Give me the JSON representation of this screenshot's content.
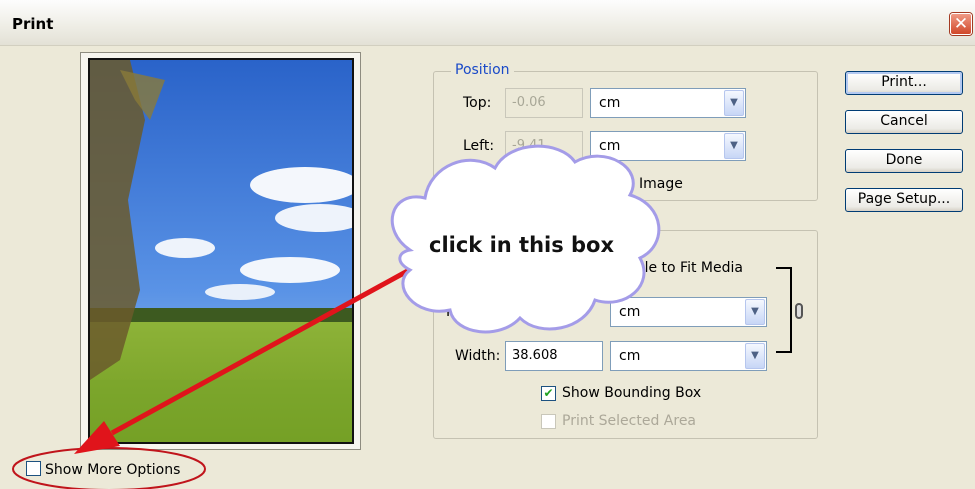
{
  "dialog": {
    "title": "Print",
    "close_glyph": "✕"
  },
  "position": {
    "legend": "Position",
    "top_label": "Top:",
    "top_value": "-0.06",
    "top_unit": "cm",
    "left_label": "Left:",
    "left_value": "-9.41",
    "left_unit": "cm",
    "center_image_partial": "Image"
  },
  "scaled": {
    "scale_to_fit_partial": "ale to Fit Media",
    "height_label_partial": "Heig",
    "height_unit_partial": "cm",
    "width_label": "Width:",
    "width_value": "38.608",
    "width_unit": "cm",
    "show_bounding_box": "Show Bounding Box",
    "show_bounding_box_checked": true,
    "print_selected_area": "Print Selected Area",
    "print_selected_area_checked": false
  },
  "buttons": {
    "print": "Print...",
    "cancel": "Cancel",
    "done": "Done",
    "page_setup": "Page Setup..."
  },
  "show_more_options": {
    "label": "Show More Options",
    "checked": false
  },
  "annotation": {
    "callout_text": "click in this box",
    "arrow_color": "#e0141b",
    "callout_border_color": "#a49ce8"
  },
  "icons": {
    "link": "chain-link-icon",
    "dropdown": "chevron-down-icon",
    "check": "checkmark-icon"
  }
}
